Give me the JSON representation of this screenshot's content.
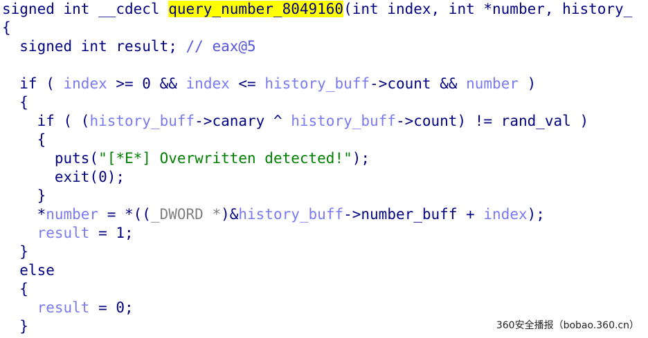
{
  "code_view": {
    "lines": [
      [
        [
          "kw",
          "signed int __cdecl "
        ],
        [
          "fn",
          "query_number_8049160"
        ],
        [
          "plain",
          "(int index, int *number, history_"
        ]
      ],
      [
        [
          "plain",
          "{"
        ]
      ],
      [
        [
          "plain",
          "  signed int result; "
        ],
        [
          "cmt",
          "// eax@5"
        ]
      ],
      [
        [
          "plain",
          ""
        ]
      ],
      [
        [
          "plain",
          "  if ( "
        ],
        [
          "var",
          "index"
        ],
        [
          "plain",
          " >= 0 && "
        ],
        [
          "var",
          "index"
        ],
        [
          "plain",
          " <= "
        ],
        [
          "var",
          "history_buff"
        ],
        [
          "plain",
          "->count && "
        ],
        [
          "var",
          "number"
        ],
        [
          "plain",
          " )"
        ]
      ],
      [
        [
          "plain",
          "  {"
        ]
      ],
      [
        [
          "plain",
          "    if ( ("
        ],
        [
          "var",
          "history_buff"
        ],
        [
          "plain",
          "->canary ^ "
        ],
        [
          "var",
          "history_buff"
        ],
        [
          "plain",
          "->count) != "
        ],
        [
          "gbl",
          "rand_val"
        ],
        [
          "plain",
          " )"
        ]
      ],
      [
        [
          "plain",
          "    {"
        ]
      ],
      [
        [
          "plain",
          "      puts("
        ],
        [
          "str",
          "\"[*E*] Overwritten detected!\""
        ],
        [
          "plain",
          ");"
        ]
      ],
      [
        [
          "plain",
          "      exit(0);"
        ]
      ],
      [
        [
          "plain",
          "    }"
        ]
      ],
      [
        [
          "plain",
          "    *"
        ],
        [
          "var",
          "number"
        ],
        [
          "plain",
          " = *(("
        ],
        [
          "type",
          "_DWORD *"
        ],
        [
          "plain",
          ")&"
        ],
        [
          "var",
          "history_buff"
        ],
        [
          "plain",
          "->number_buff + "
        ],
        [
          "var",
          "index"
        ],
        [
          "plain",
          ");"
        ]
      ],
      [
        [
          "plain",
          "    "
        ],
        [
          "var",
          "result"
        ],
        [
          "plain",
          " = 1;"
        ]
      ],
      [
        [
          "plain",
          "  }"
        ]
      ],
      [
        [
          "plain",
          "  else"
        ]
      ],
      [
        [
          "plain",
          "  {"
        ]
      ],
      [
        [
          "plain",
          "    "
        ],
        [
          "var",
          "result"
        ],
        [
          "plain",
          " = 0;"
        ]
      ],
      [
        [
          "plain",
          "  }"
        ]
      ]
    ]
  },
  "watermark": {
    "text": "360安全播报（bobao.360.cn）"
  },
  "colors": {
    "background": "#ffffff",
    "code_text": "#000080",
    "variable": "#7a7af0",
    "string": "#008000",
    "comment": "#5555dd",
    "cast_type": "#808080",
    "function_highlight": "#ffff00"
  }
}
